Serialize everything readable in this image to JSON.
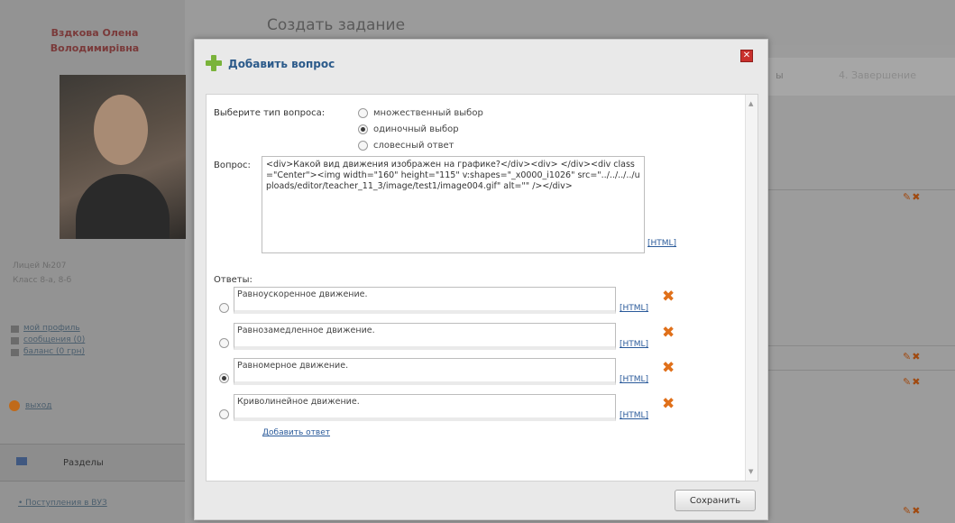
{
  "background": {
    "page_title": "Создать задание",
    "user_name": "Вздкова Олена Володимирівна",
    "school": "Лицей №207",
    "class": "Класс 8-а, 8-б",
    "links": [
      "мой профиль",
      "сообщения (0)",
      "баланс (0 грн)"
    ],
    "exit_label": "выход",
    "sections_label": "Разделы",
    "bullet_link": "Поступления в ВУЗ",
    "steps": [
      "ы",
      "4. Завершение"
    ]
  },
  "modal": {
    "title": "Добавить вопрос",
    "close_icon": "close-icon",
    "type_label": "Выберите тип вопроса:",
    "types": [
      {
        "label": "множественный выбор",
        "checked": false
      },
      {
        "label": "одиночный выбор",
        "checked": true
      },
      {
        "label": "словесный ответ",
        "checked": false
      }
    ],
    "question_label": "Вопрос:",
    "question_value": "<div>Какой вид движения изображен на графике?</div><div> </div><div class=\"Center\"><img width=\"160\" height=\"115\" v:shapes=\"_x0000_i1026\" src=\"../../../../uploads/editor/teacher_11_3/image/test1/image004.gif\" alt=\"\" /></div>",
    "html_label": "[HTML]",
    "answers_label": "Ответы:",
    "answers": [
      {
        "text": "Равноускоренное движение.",
        "checked": false
      },
      {
        "text": "Равнозамедленное движение.",
        "checked": false
      },
      {
        "text": "Равномерное движение.",
        "checked": true
      },
      {
        "text": "Криволинейное движение.",
        "checked": false
      }
    ],
    "add_answer_label": "Добавить ответ",
    "save_label": "Сохранить",
    "accent_color": "#2b5a8a",
    "delete_color": "#e0701a"
  }
}
